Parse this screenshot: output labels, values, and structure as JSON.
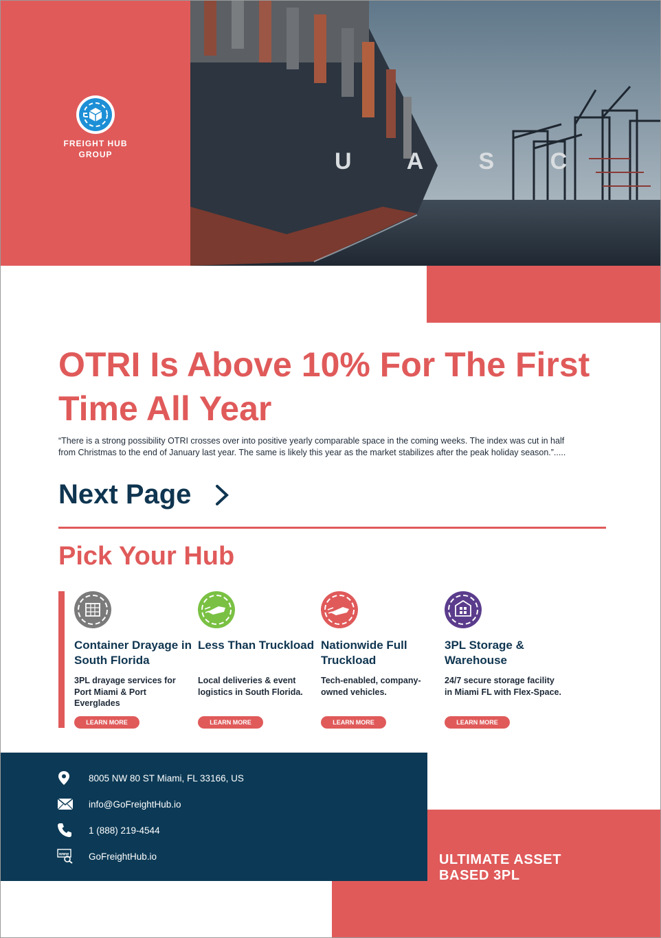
{
  "brand": {
    "name": "FREIGHT HUB\nGROUP",
    "accent_color": "#e05a5a",
    "navy_color": "#0c3a56",
    "logo_icon": "shipping-box-icon"
  },
  "hero": {
    "photo_caption": "container ship at port",
    "ship_lettering": "U A S C"
  },
  "article": {
    "headline": "OTRI Is Above 10% For The First Time All Year",
    "quote": "“There is a strong possibility OTRI crosses over into positive yearly comparable space in the coming weeks. The index was cut in half from Christmas to the end of January last year. The same is likely this year as the market stabilizes after the peak holiday season.”.....",
    "next_label": "Next Page",
    "next_icon": "chevron-right-icon"
  },
  "hubs": {
    "title": "Pick Your Hub",
    "items": [
      {
        "title": "Container Drayage in South Florida",
        "description": "3PL drayage services for Port Miami & Port Everglades",
        "button": "LEARN MORE",
        "color": "#7b7b7b",
        "icon": "container-icon"
      },
      {
        "title": "Less Than Truckload",
        "description": "Local deliveries & event logistics in South Florida.",
        "button": "LEARN MORE",
        "color": "#7ac143",
        "icon": "truck-icon"
      },
      {
        "title": "Nationwide Full Truckload",
        "description": "Tech-enabled, company-owned vehicles.",
        "button": "LEARN MORE",
        "color": "#e05a5a",
        "icon": "truck-icon"
      },
      {
        "title": "3PL Storage & Warehouse",
        "description": "24/7 secure storage facility in Miami FL with Flex-Space.",
        "button": "LEARN MORE",
        "color": "#5b3c8c",
        "icon": "warehouse-icon"
      }
    ]
  },
  "contact": {
    "address": "8005 NW 80 ST Miami, FL 33166, US",
    "email": "info@GoFreightHub.io",
    "phone": "1 (888) 219-4544",
    "website": "GoFreightHub.io",
    "web_icon_label": "www"
  },
  "footer": {
    "tagline": "ULTIMATE ASSET\nBASED 3PL"
  }
}
